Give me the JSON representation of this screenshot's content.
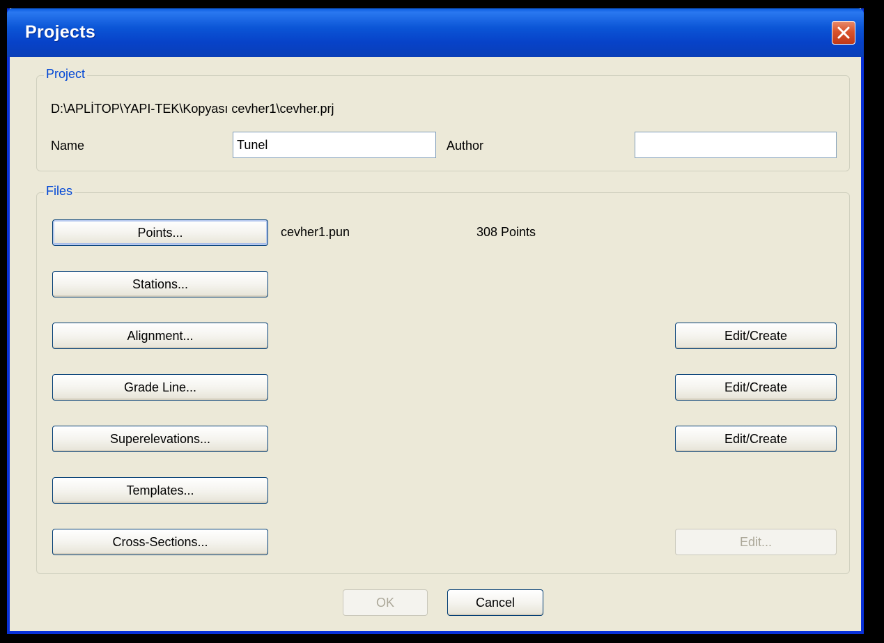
{
  "window": {
    "title": "Projects"
  },
  "project_group": {
    "legend": "Project",
    "path": "D:\\APLİTOP\\YAPI-TEK\\Kopyası cevher1\\cevher.prj",
    "name_label": "Name",
    "name_value": "Tunel",
    "author_label": "Author",
    "author_value": ""
  },
  "files_group": {
    "legend": "Files",
    "points_button": "Points...",
    "points_file": "cevher1.pun",
    "points_count": "308 Points",
    "stations_button": "Stations...",
    "alignment_button": "Alignment...",
    "alignment_edit": "Edit/Create",
    "grade_line_button": "Grade Line...",
    "grade_line_edit": "Edit/Create",
    "superelevations_button": "Superelevations...",
    "superelevations_edit": "Edit/Create",
    "templates_button": "Templates...",
    "cross_sections_button": "Cross-Sections...",
    "cross_sections_edit": "Edit..."
  },
  "footer": {
    "ok_label": "OK",
    "cancel_label": "Cancel"
  }
}
